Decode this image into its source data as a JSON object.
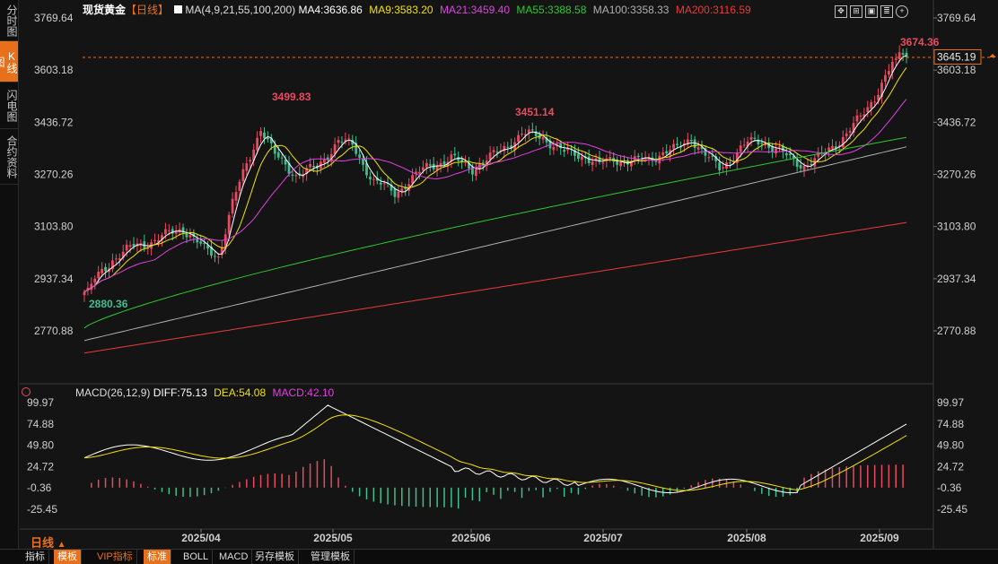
{
  "sidebar": [
    "分时图",
    "K线图",
    "闪电图",
    "合约资料"
  ],
  "header": {
    "instrument": "现货黄金",
    "period_tag": "【日线】",
    "ma_params": "MA(4,9,21,55,100,200)",
    "ma4": "MA4:3636.86",
    "ma9": "MA9:3583.20",
    "ma21": "MA21:3459.40",
    "ma55": "MA55:3388.58",
    "ma100": "MA100:3358.33",
    "ma200": "MA200:3116.59"
  },
  "toolbar_icons": [
    "move-icon",
    "zoom-icon",
    "image-icon",
    "list-icon",
    "add-icon"
  ],
  "price_axis": [
    "3769.64",
    "3603.18",
    "3436.72",
    "3270.26",
    "3103.80",
    "2937.34",
    "2770.88"
  ],
  "current_price": "3645.19",
  "annotations": {
    "high_all": "3674.36",
    "high_apr": "3499.83",
    "high_jun": "3451.14",
    "low": "2880.36"
  },
  "macd": {
    "params": "MACD(26,12,9)",
    "diff": "DIFF:75.13",
    "dea": "DEA:54.08",
    "macd": "MACD:42.10",
    "axis": [
      "99.97",
      "74.88",
      "49.80",
      "24.72",
      "-0.36",
      "-25.45"
    ]
  },
  "dates": [
    "2025/04",
    "2025/05",
    "2025/06",
    "2025/07",
    "2025/08",
    "2025/09"
  ],
  "period_label": "日线",
  "bottom_tabs": [
    "指标",
    "模板",
    "VIP指标",
    "标准",
    "BOLL",
    "MACD",
    "另存模板",
    "管理模板"
  ],
  "colors": {
    "up": "#e84a5f",
    "down": "#3fbf8f",
    "ma4": "#ffffff",
    "ma9": "#f2e000",
    "ma21": "#e040e0",
    "ma55": "#2ec82e",
    "ma100": "#b0b0b0",
    "ma200": "#e83a3a",
    "accent": "#e8701a"
  },
  "chart_data": [
    {
      "type": "candlestick",
      "title": "现货黄金 日线",
      "x": [
        "2025/04",
        "2025/05",
        "2025/06",
        "2025/07",
        "2025/08",
        "2025/09"
      ],
      "close_approx": [
        3040,
        3290,
        3300,
        3340,
        3340,
        3645.19
      ],
      "annotated_high": 3674.36,
      "annotated_low": 2880.36,
      "series": [
        {
          "name": "MA4",
          "last": 3636.86
        },
        {
          "name": "MA9",
          "last": 3583.2
        },
        {
          "name": "MA21",
          "last": 3459.4
        },
        {
          "name": "MA55",
          "last": 3388.58
        },
        {
          "name": "MA100",
          "last": 3358.33
        },
        {
          "name": "MA200",
          "last": 3116.59
        }
      ],
      "ylim": [
        2770.88,
        3769.64
      ]
    },
    {
      "type": "bar",
      "title": "MACD(26,12,9)",
      "series": [
        {
          "name": "DIFF",
          "last": 75.13
        },
        {
          "name": "DEA",
          "last": 54.08
        },
        {
          "name": "MACD",
          "last": 42.1
        }
      ],
      "ylim": [
        -25.45,
        99.97
      ]
    }
  ]
}
